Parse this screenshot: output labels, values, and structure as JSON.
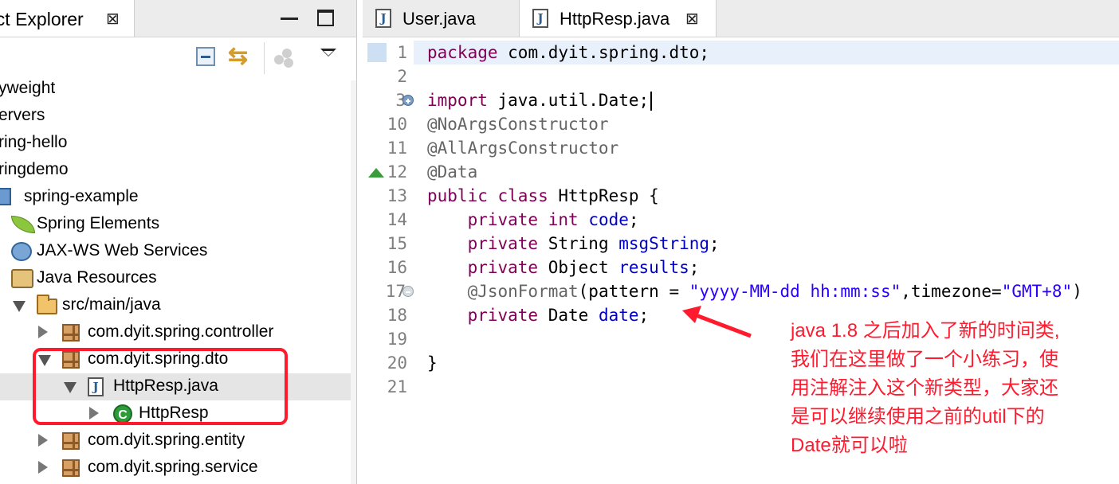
{
  "colors": {
    "keyword": "#7f0055",
    "field": "#0000c0",
    "string": "#2a00ff",
    "annotation_code": "#646464",
    "callout_red": "#ff1a2e",
    "current_line": "#e8f0fb"
  },
  "project_explorer": {
    "tab_title": "ect Explorer",
    "close_icon": "close-icon",
    "tree": [
      {
        "label": "yweight",
        "icon": "",
        "indent": 0,
        "twisty": ""
      },
      {
        "label": "ervers",
        "icon": "",
        "indent": 0,
        "twisty": ""
      },
      {
        "label": "ring-hello",
        "icon": "",
        "indent": 0,
        "twisty": ""
      },
      {
        "label": "ringdemo",
        "icon": "",
        "indent": 0,
        "twisty": ""
      },
      {
        "label": "spring-example",
        "icon": "project-icon",
        "indent": 0,
        "twisty": ""
      },
      {
        "label": "Spring Elements",
        "icon": "spring-leaf-icon",
        "indent": 1,
        "twisty": ""
      },
      {
        "label": "JAX-WS Web Services",
        "icon": "web-services-icon",
        "indent": 1,
        "twisty": ""
      },
      {
        "label": "Java Resources",
        "icon": "java-resources-icon",
        "indent": 1,
        "twisty": ""
      },
      {
        "label": "src/main/java",
        "icon": "source-folder-icon",
        "indent": 2,
        "twisty": "expanded"
      },
      {
        "label": "com.dyit.spring.controller",
        "icon": "package-icon",
        "indent": 3,
        "twisty": "collapsed"
      },
      {
        "label": "com.dyit.spring.dto",
        "icon": "package-icon",
        "indent": 3,
        "twisty": "expanded"
      },
      {
        "label": "HttpResp.java",
        "icon": "java-file-icon",
        "indent": 4,
        "twisty": "expanded",
        "selected": true
      },
      {
        "label": "HttpResp",
        "icon": "class-icon",
        "indent": 5,
        "twisty": "collapsed"
      },
      {
        "label": "com.dyit.spring.entity",
        "icon": "package-icon",
        "indent": 3,
        "twisty": "collapsed"
      },
      {
        "label": "com.dyit.spring.service",
        "icon": "package-icon",
        "indent": 3,
        "twisty": "collapsed"
      }
    ]
  },
  "editor": {
    "tabs": [
      {
        "label": "User.java",
        "active": false
      },
      {
        "label": "HttpResp.java",
        "active": true
      }
    ],
    "lines": [
      {
        "num": "1",
        "tokens": [
          {
            "t": "package",
            "c": "kw"
          },
          {
            "t": " com.dyit.spring.dto;",
            "c": ""
          }
        ],
        "current": true,
        "marker": "bookmark"
      },
      {
        "num": "2",
        "tokens": []
      },
      {
        "num": "3",
        "tokens": [
          {
            "t": "import",
            "c": "kw"
          },
          {
            "t": " java.util.Date;",
            "c": ""
          }
        ],
        "marker": "fold-plus",
        "caret": true
      },
      {
        "num": "10",
        "tokens": [
          {
            "t": "@NoArgsConstructor",
            "c": "ann"
          }
        ]
      },
      {
        "num": "11",
        "tokens": [
          {
            "t": "@AllArgsConstructor",
            "c": "ann"
          }
        ]
      },
      {
        "num": "12",
        "tokens": [
          {
            "t": "@Data",
            "c": "ann"
          }
        ],
        "marker": "override"
      },
      {
        "num": "13",
        "tokens": [
          {
            "t": "public",
            "c": "kw"
          },
          {
            "t": " ",
            "c": ""
          },
          {
            "t": "class",
            "c": "kw"
          },
          {
            "t": " HttpResp {",
            "c": ""
          }
        ]
      },
      {
        "num": "14",
        "tokens": [
          {
            "t": "    ",
            "c": ""
          },
          {
            "t": "private",
            "c": "kw"
          },
          {
            "t": " ",
            "c": ""
          },
          {
            "t": "int",
            "c": "kw"
          },
          {
            "t": " ",
            "c": ""
          },
          {
            "t": "code",
            "c": "fld"
          },
          {
            "t": ";",
            "c": ""
          }
        ]
      },
      {
        "num": "15",
        "tokens": [
          {
            "t": "    ",
            "c": ""
          },
          {
            "t": "private",
            "c": "kw"
          },
          {
            "t": " String ",
            "c": ""
          },
          {
            "t": "msgString",
            "c": "fld"
          },
          {
            "t": ";",
            "c": ""
          }
        ]
      },
      {
        "num": "16",
        "tokens": [
          {
            "t": "    ",
            "c": ""
          },
          {
            "t": "private",
            "c": "kw"
          },
          {
            "t": " Object ",
            "c": ""
          },
          {
            "t": "results",
            "c": "fld"
          },
          {
            "t": ";",
            "c": ""
          }
        ]
      },
      {
        "num": "17",
        "tokens": [
          {
            "t": "    ",
            "c": ""
          },
          {
            "t": "@JsonFormat",
            "c": "ann"
          },
          {
            "t": "(pattern = ",
            "c": ""
          },
          {
            "t": "\"yyyy-MM-dd hh:mm:ss\"",
            "c": "str"
          },
          {
            "t": ",timezone=",
            "c": ""
          },
          {
            "t": "\"GMT+8\"",
            "c": "str"
          },
          {
            "t": ")",
            "c": ""
          }
        ],
        "marker": "fold-minus"
      },
      {
        "num": "18",
        "tokens": [
          {
            "t": "    ",
            "c": ""
          },
          {
            "t": "private",
            "c": "kw"
          },
          {
            "t": " Date ",
            "c": ""
          },
          {
            "t": "date",
            "c": "fld"
          },
          {
            "t": ";",
            "c": ""
          }
        ]
      },
      {
        "num": "19",
        "tokens": []
      },
      {
        "num": "20",
        "tokens": [
          {
            "t": "}",
            "c": ""
          }
        ]
      },
      {
        "num": "21",
        "tokens": []
      }
    ]
  },
  "callout": {
    "lines": [
      "java 1.8 之后加入了新的时间类,",
      "我们在这里做了一个小练习，使",
      "用注解注入这个新类型，大家还",
      "是可以继续使用之前的util下的",
      "Date就可以啦"
    ]
  }
}
